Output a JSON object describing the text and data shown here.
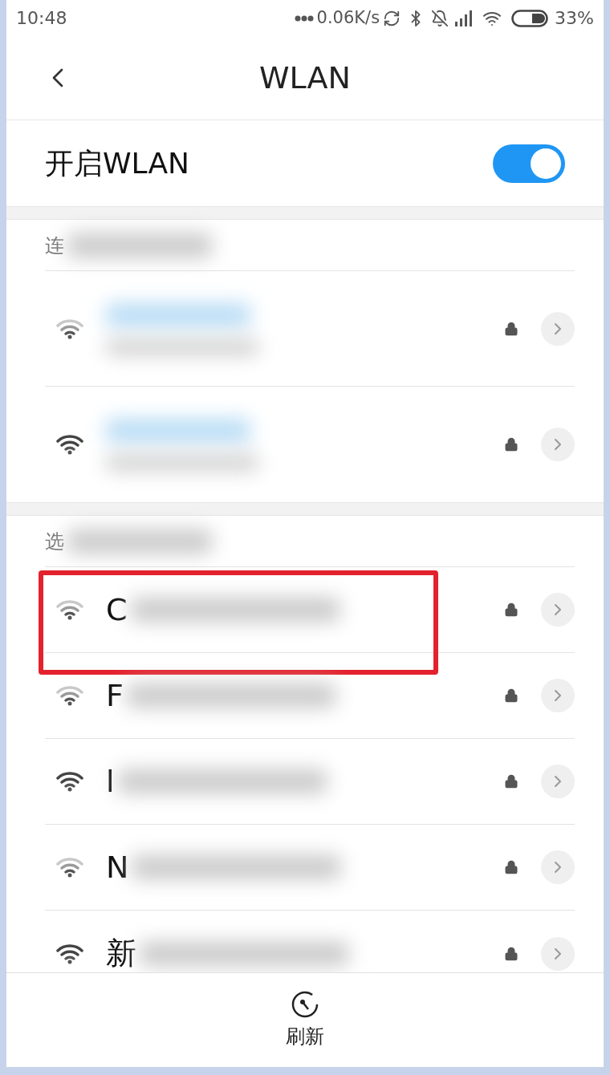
{
  "status_bar": {
    "time": "10:48",
    "speed": "0.06K/s",
    "battery": "33%"
  },
  "header": {
    "title": "WLAN"
  },
  "wlan_toggle": {
    "label": "开启WLAN",
    "on": true
  },
  "sections": [
    {
      "heading": "连",
      "networks": [
        {
          "strong": false,
          "locked": true,
          "highlighted": false,
          "subtitle": true
        },
        {
          "strong": true,
          "locked": true,
          "highlighted": false,
          "subtitle": true
        }
      ]
    },
    {
      "heading": "选",
      "networks": [
        {
          "name": "C",
          "strong": false,
          "locked": true,
          "highlighted": true,
          "subtitle": false
        },
        {
          "name": "F",
          "strong": false,
          "locked": true,
          "highlighted": false,
          "subtitle": false
        },
        {
          "name": "l",
          "strong": true,
          "locked": true,
          "highlighted": false,
          "subtitle": false
        },
        {
          "name": "N",
          "strong": false,
          "locked": true,
          "highlighted": false,
          "subtitle": false
        },
        {
          "name": "新",
          "strong": true,
          "locked": true,
          "highlighted": false,
          "subtitle": false
        }
      ]
    }
  ],
  "bottom_action": {
    "label": "刷新"
  }
}
